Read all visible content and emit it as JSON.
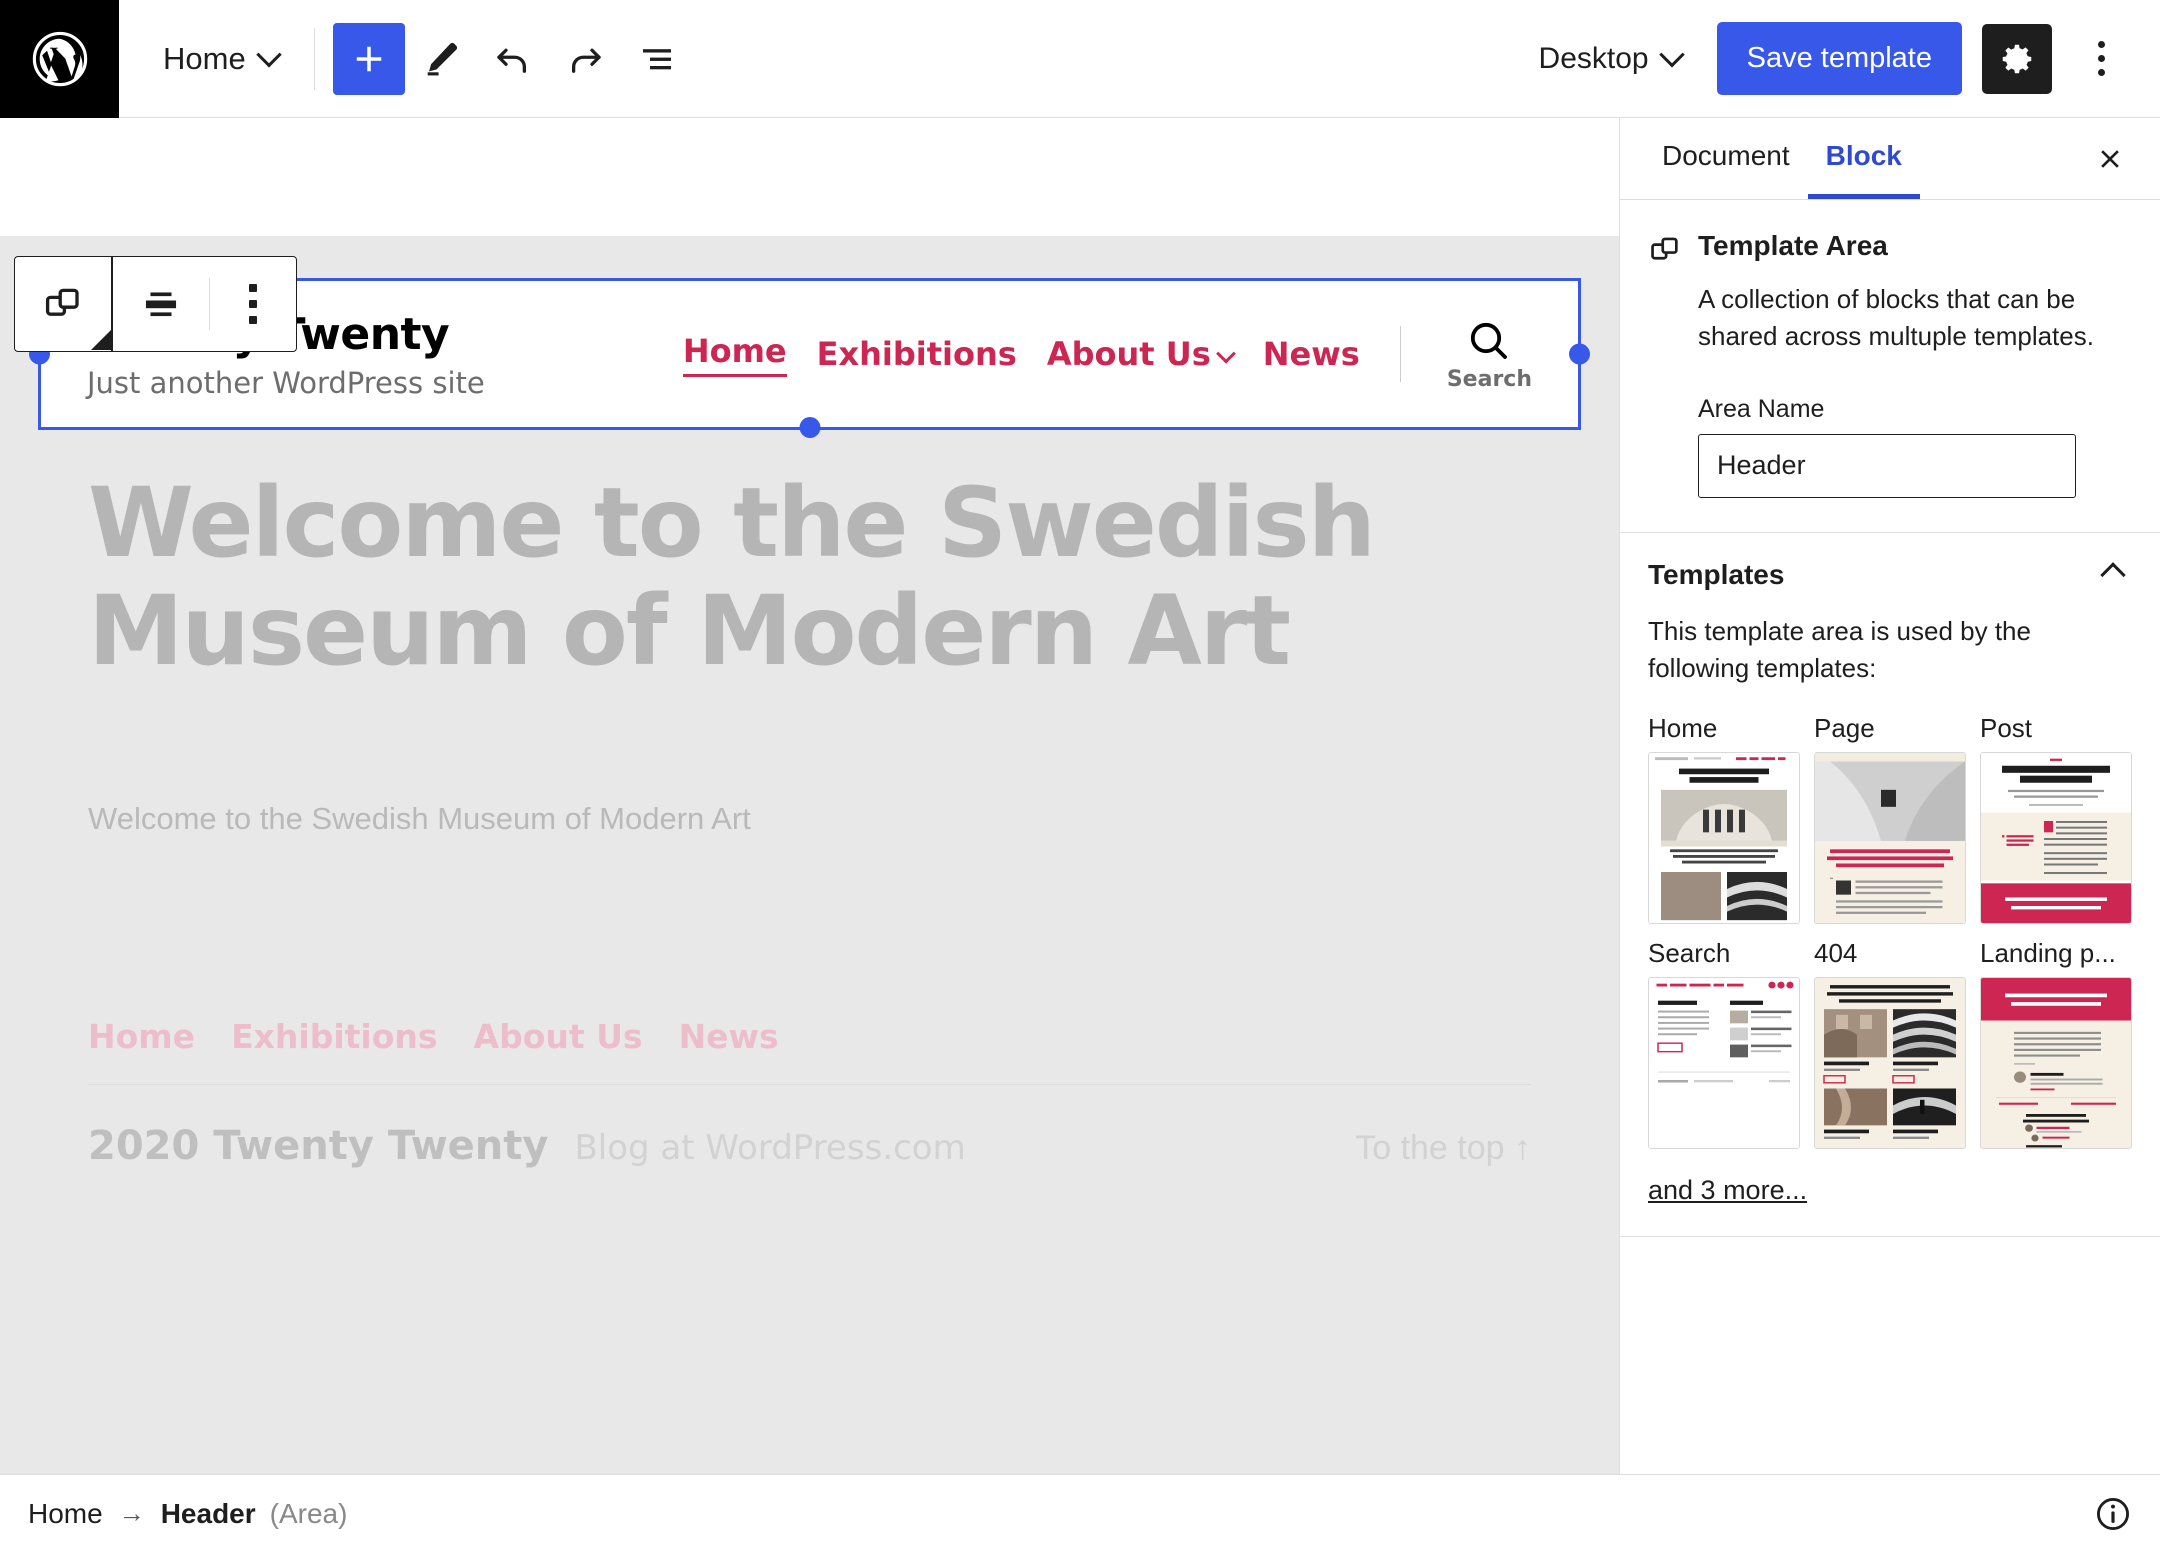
{
  "topbar": {
    "logo_icon": "wordpress-logo-icon",
    "document_name": "Home",
    "add_block_icon": "plus-icon",
    "tools_icon": "pencil-icon",
    "undo_icon": "undo-arrow-icon",
    "redo_icon": "redo-arrow-icon",
    "list_view_icon": "list-view-icon",
    "device_preview": "Desktop",
    "save_label": "Save template",
    "settings_icon": "gear-icon",
    "options_icon": "kebab-menu-icon",
    "accent_color": "#3858e9"
  },
  "block_toolbar": {
    "block_type_icon": "template-area-icon",
    "align_icon": "align-wide-icon",
    "options_icon": "kebab-menu-icon"
  },
  "canvas": {
    "site_title": "Twenty Twenty",
    "site_tagline": "Just another WordPress site",
    "header_nav": [
      {
        "label": "Home",
        "active": true,
        "has_submenu": false
      },
      {
        "label": "Exhibitions",
        "active": false,
        "has_submenu": false
      },
      {
        "label": "About Us",
        "active": false,
        "has_submenu": true
      },
      {
        "label": "News",
        "active": false,
        "has_submenu": false
      }
    ],
    "search_icon": "search-magnifier-icon",
    "search_label": "Search",
    "page_heading": "Welcome to the Swedish Museum of Modern Art",
    "page_excerpt": "Welcome to the Swedish Museum of Modern Art",
    "footer_nav": [
      "Home",
      "Exhibitions",
      "About Us",
      "News"
    ],
    "footer_copyright": "2020 Twenty Twenty",
    "footer_credit": "Blog at WordPress.com",
    "footer_to_top": "To the top ↑",
    "link_color": "#cd2653",
    "selection_color": "#3858e9"
  },
  "sidebar": {
    "tabs": [
      {
        "label": "Document",
        "active": false
      },
      {
        "label": "Block",
        "active": true
      }
    ],
    "close_icon": "close-x-icon",
    "block": {
      "icon": "template-area-icon",
      "title": "Template Area",
      "description": "A collection of blocks that can be shared across multuple templates.",
      "area_name_label": "Area Name",
      "area_name_value": "Header"
    },
    "templates_panel": {
      "title": "Templates",
      "collapse_icon": "chevron-up-icon",
      "note": "This template area is used by the following templates:",
      "items": [
        {
          "name": "Home",
          "thumb": "home-template-thumbnail"
        },
        {
          "name": "Page",
          "thumb": "page-template-thumbnail"
        },
        {
          "name": "Post",
          "thumb": "post-template-thumbnail"
        },
        {
          "name": "Search",
          "thumb": "search-template-thumbnail"
        },
        {
          "name": "404",
          "thumb": "404-template-thumbnail"
        },
        {
          "name": "Landing p...",
          "thumb": "landing-page-template-thumbnail"
        }
      ],
      "more_link": "and 3 more..."
    }
  },
  "statusbar": {
    "breadcrumb_root": "Home",
    "breadcrumb_arrow": "→",
    "breadcrumb_current": "Header",
    "breadcrumb_suffix": "(Area)",
    "info_icon": "info-circle-icon"
  }
}
